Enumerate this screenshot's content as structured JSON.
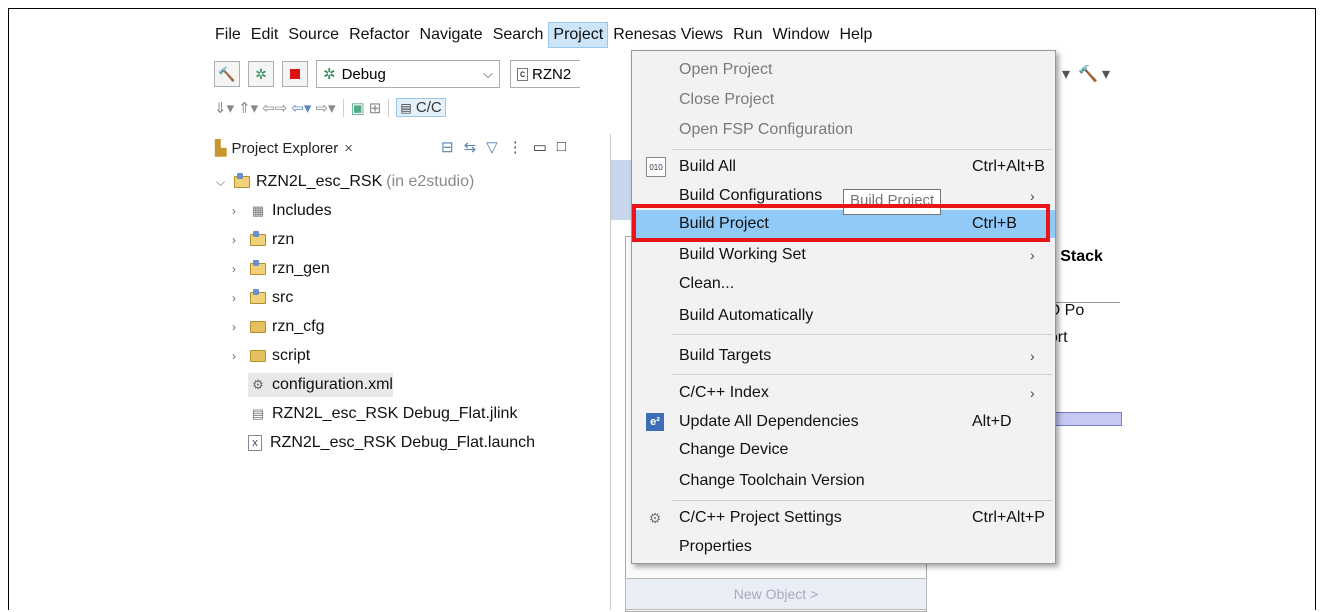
{
  "menubar": [
    "File",
    "Edit",
    "Source",
    "Refactor",
    "Navigate",
    "Search",
    "Project",
    "Renesas Views",
    "Run",
    "Window",
    "Help"
  ],
  "toolbar": {
    "config_combo": "Debug",
    "target_combo": "RZN2",
    "perspective_label": "C/C"
  },
  "project_explorer": {
    "title": "Project Explorer",
    "root": {
      "name": "RZN2L_esc_RSK",
      "note": "(in e2studio)"
    },
    "children": [
      {
        "name": "Includes",
        "type": "includes"
      },
      {
        "name": "rzn",
        "type": "srcfolder"
      },
      {
        "name": "rzn_gen",
        "type": "srcfolder"
      },
      {
        "name": "src",
        "type": "srcfolder"
      },
      {
        "name": "rzn_cfg",
        "type": "folder"
      },
      {
        "name": "script",
        "type": "folder"
      },
      {
        "name": "configuration.xml",
        "type": "file"
      },
      {
        "name": "RZN2L_esc_RSK Debug_Flat.jlink",
        "type": "file"
      },
      {
        "name": "RZN2L_esc_RSK Debug_Flat.launch",
        "type": "file"
      }
    ]
  },
  "editor_partial": {
    "stacks_fragment": "n Stack",
    "io_fragment": "t I/O Po",
    "support_fragment": "port",
    "new_object": "New Object >"
  },
  "project_menu": {
    "items": [
      {
        "label": "Open Project",
        "disabled": true
      },
      {
        "label": "Close Project",
        "disabled": true
      },
      {
        "label": "Open FSP Configuration",
        "disabled": true
      },
      {
        "label": "Build All",
        "shortcut": "Ctrl+Alt+B",
        "icon": "build-all-icon"
      },
      {
        "label": "Build Configurations",
        "submenu": true
      },
      {
        "label": "Build Project",
        "shortcut": "Ctrl+B",
        "highlighted": true
      },
      {
        "label": "Build Working Set",
        "submenu": true
      },
      {
        "label": "Clean..."
      },
      {
        "label": "Build Automatically"
      },
      {
        "label": "Build Targets",
        "submenu": true
      },
      {
        "label": "C/C++ Index",
        "submenu": true
      },
      {
        "label": "Update All Dependencies",
        "shortcut": "Alt+D",
        "icon": "e2-icon"
      },
      {
        "label": "Change Device"
      },
      {
        "label": "Change Toolchain Version"
      },
      {
        "label": "C/C++ Project Settings",
        "shortcut": "Ctrl+Alt+P",
        "icon": "settings-icon"
      },
      {
        "label": "Properties"
      }
    ],
    "tooltip": "Build Project"
  },
  "colors": {
    "highlight": "#91c9f7",
    "annotation_red": "#e8141a",
    "menu_bg": "#f2f2f2"
  }
}
